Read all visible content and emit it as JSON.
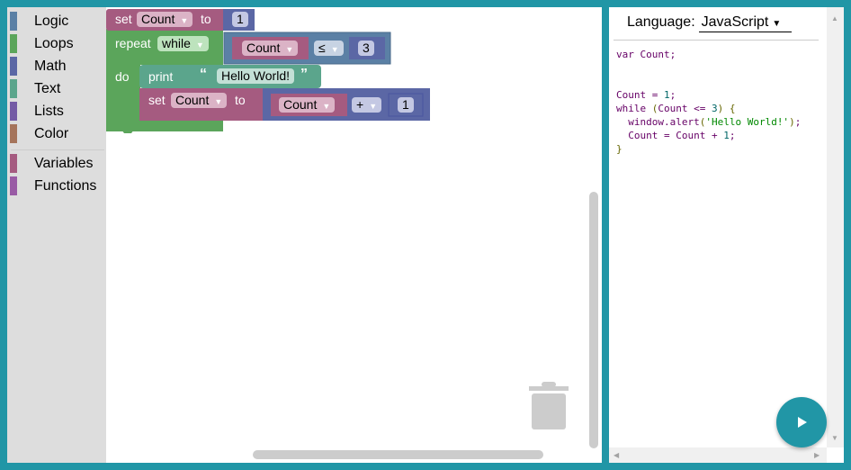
{
  "toolbox": {
    "categories": [
      {
        "label": "Logic",
        "color": "#5b80a5"
      },
      {
        "label": "Loops",
        "color": "#5ba55b"
      },
      {
        "label": "Math",
        "color": "#5b67a5"
      },
      {
        "label": "Text",
        "color": "#5ba58c"
      },
      {
        "label": "Lists",
        "color": "#745ba5"
      },
      {
        "label": "Color",
        "color": "#a5745b"
      },
      {
        "label": "Variables",
        "color": "#a55b80"
      },
      {
        "label": "Functions",
        "color": "#995ba5"
      }
    ]
  },
  "blocks": {
    "set1": {
      "keyword": "set",
      "variable": "Count",
      "to": "to",
      "value": "1"
    },
    "repeat": {
      "keyword": "repeat",
      "mode": "while",
      "do": "do",
      "cond_var": "Count",
      "cond_op": "≤",
      "cond_value": "3"
    },
    "print": {
      "keyword": "print",
      "open_quote": "“",
      "text": "Hello World!",
      "close_quote": "”"
    },
    "set2": {
      "keyword": "set",
      "variable": "Count",
      "to": "to",
      "expr_var": "Count",
      "expr_op": "+",
      "expr_value": "1"
    },
    "dropdown_arrow": "▼"
  },
  "code_panel": {
    "language_label": "Language:",
    "language_value": "JavaScript",
    "dropdown_icon": "▼",
    "code_lines": [
      "var Count;",
      "",
      "",
      "Count = 1;",
      "while (Count <= 3) {",
      "  window.alert('Hello World!');",
      "  Count = Count + 1;",
      "}"
    ]
  },
  "colors": {
    "frame": "#2196a6",
    "variables": "#a55b80",
    "loops": "#5ba55b",
    "logic": "#5b80a5",
    "math": "#5b67a5",
    "text": "#5ba58c"
  }
}
